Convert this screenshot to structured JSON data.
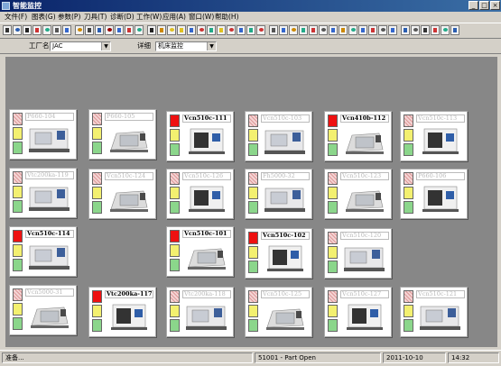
{
  "window": {
    "title": "智能监控"
  },
  "menu": [
    "文件(F)",
    "图表(G)",
    "参数(P)",
    "刀具(T)",
    "诊断(D)",
    "工作(W)",
    "应用(A)",
    "窗口(W)",
    "帮助(H)"
  ],
  "filters": {
    "factory_label": "工厂名",
    "factory_value": "JAC",
    "detail_label": "详细",
    "detail_value": "机床监控"
  },
  "machines": [
    {
      "name": "P660-104",
      "active": false
    },
    {
      "name": "P660-105",
      "active": false
    },
    {
      "name": "Vcn510c-111",
      "active": true
    },
    {
      "name": "Vcn510c-103",
      "active": false
    },
    {
      "name": "Vcn410b-112",
      "active": true
    },
    {
      "name": "Vcn510c-113",
      "active": false
    },
    {
      "name": "Vtc200ka-119",
      "active": false
    },
    {
      "name": "Vcn510c-124",
      "active": false
    },
    {
      "name": "Vcn510c-126",
      "active": false
    },
    {
      "name": "Fh5000-32",
      "active": false
    },
    {
      "name": "Vcn510c-123",
      "active": false
    },
    {
      "name": "P660-106",
      "active": false
    },
    {
      "name": "Vcn510c-114",
      "active": true
    },
    {
      "name": "Vcn510c-101",
      "active": true
    },
    {
      "name": "Vcn510c-102",
      "active": true
    },
    {
      "name": "Vcn510c-120",
      "active": false
    },
    {
      "name": "Vcn5000-31",
      "active": false
    },
    {
      "name": "Vtc200ka-117",
      "active": true
    },
    {
      "name": "Vtc200ka-118",
      "active": false
    },
    {
      "name": "Vcn510c-125",
      "active": false
    },
    {
      "name": "Vcn510c-127",
      "active": false
    },
    {
      "name": "Vcn510c-121",
      "active": false
    }
  ],
  "status": {
    "ready": "准备...",
    "message": "51001 - Part Open",
    "date": "2011-10-10",
    "time": "14:32"
  },
  "colors": {
    "alarm": "#ee1111",
    "warning": "#f3f070",
    "running": "#8bd68b",
    "workspace": "#878787"
  }
}
